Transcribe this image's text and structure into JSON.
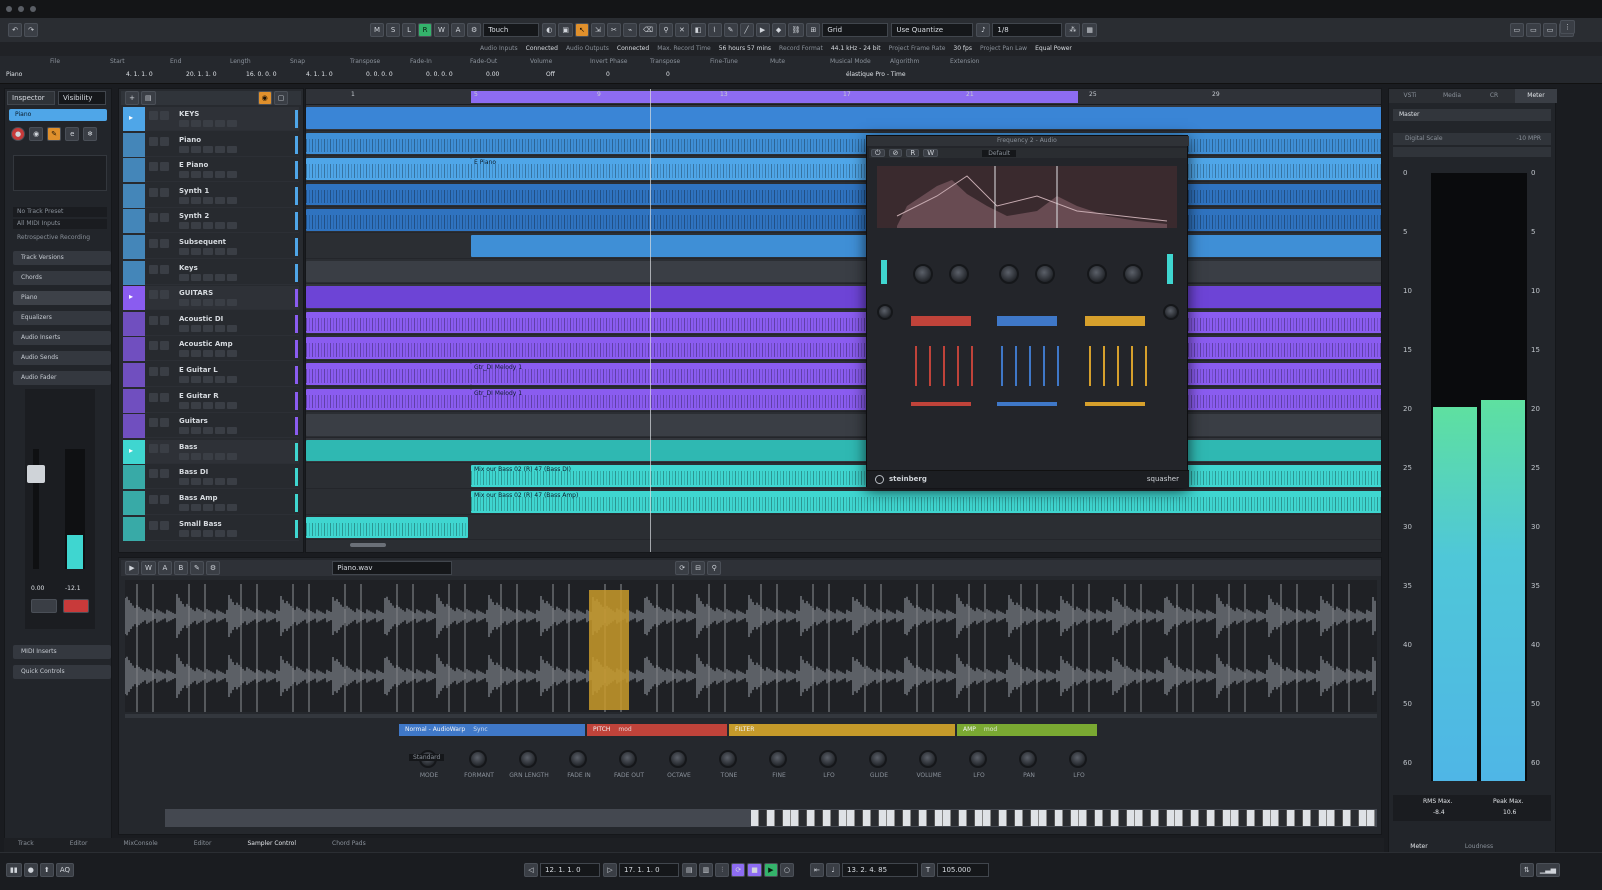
{
  "toolbar": {
    "automation_mode": "Touch",
    "grid_mode": "Grid",
    "quantize_mode": "Use Quantize",
    "quantize_value": "1/8"
  },
  "status_line": [
    "Audio Inputs",
    "Connected",
    "Audio Outputs",
    "Connected",
    "Max. Record Time",
    "56 hours 57 mins",
    "Record Format",
    "44.1 kHz - 24 bit",
    "Project Frame Rate",
    "30 fps",
    "Project Pan Law",
    "Equal Power"
  ],
  "info_line": {
    "headers": [
      "File",
      "Start",
      "End",
      "Length",
      "Snap",
      "Transpose",
      "Fade-In",
      "Fade-Out",
      "Volume",
      "Invert Phase",
      "Transpose",
      "Fine-Tune",
      "Mute",
      "Musical Mode",
      "Algorithm",
      "Extension"
    ],
    "track_name": "Piano",
    "start": "4. 1. 1. 0",
    "end": "20. 1. 1. 0",
    "length": "16. 0. 0. 0",
    "snap": "4. 1. 1. 0",
    "fade_in": "0. 0. 0. 0",
    "fade_out": "0. 0. 0. 0",
    "volume": "0.00",
    "invert_phase": "Off",
    "transpose": "0",
    "fine_tune": "0",
    "algorithm": "élastique Pro - Time"
  },
  "inspector": {
    "tabs": [
      "Inspector",
      "Visibility"
    ],
    "track": "Piano",
    "input": "No Track Preset",
    "midi_inputs": "All MIDI Inputs",
    "retro": "Retrospective Recording",
    "sections": [
      "Track Versions",
      "Chords",
      "Piano",
      "Equalizers",
      "Audio Inserts",
      "Audio Sends",
      "Audio Fader",
      "MIDI Inserts",
      "Quick Controls"
    ],
    "fader_value": "0.00",
    "fader_value_right": "-12.1"
  },
  "tracks": [
    {
      "name": "KEYS",
      "color": "#4fa6e8",
      "folder": true
    },
    {
      "name": "Piano",
      "color": "#4fa6e8"
    },
    {
      "name": "E Piano",
      "color": "#4fa6e8"
    },
    {
      "name": "Synth 1",
      "color": "#4fa6e8"
    },
    {
      "name": "Synth 2",
      "color": "#4fa6e8"
    },
    {
      "name": "Subsequent",
      "color": "#4fa6e8"
    },
    {
      "name": "Keys",
      "color": "#4fa6e8"
    },
    {
      "name": "GUITARS",
      "color": "#8a5cf0",
      "folder": true
    },
    {
      "name": "Acoustic DI",
      "color": "#8a5cf0"
    },
    {
      "name": "Acoustic Amp",
      "color": "#8a5cf0"
    },
    {
      "name": "E Guitar L",
      "color": "#8a5cf0"
    },
    {
      "name": "E Guitar R",
      "color": "#8a5cf0"
    },
    {
      "name": "Guitars",
      "color": "#8a5cf0"
    },
    {
      "name": "Bass",
      "color": "#3fd6d0",
      "folder": true
    },
    {
      "name": "Bass DI",
      "color": "#3fd6d0"
    },
    {
      "name": "Bass Amp",
      "color": "#3fd6d0"
    },
    {
      "name": "Small Bass",
      "color": "#3fd6d0"
    }
  ],
  "clip_labels": {
    "epiano": "E Piano",
    "gtr1": "Gtr_DI Melody 1",
    "gtr2": "Gtr_DI Melody 1",
    "bass1": "Mix our Bass 02 (R) 47 (Bass DI)",
    "bass2": "Mix our Bass 02 (R) 47 (Bass Amp)"
  },
  "ruler": [
    "1",
    "5",
    "9",
    "13",
    "17",
    "21",
    "25",
    "29"
  ],
  "plugin": {
    "title": "Frequency 2 - Audio",
    "preset": "Default",
    "brand": "steinberg",
    "product": "squasher"
  },
  "right_zone": {
    "tabs": [
      "VSTi",
      "Media",
      "CR",
      "Meter"
    ],
    "section": "Master",
    "loudness_label": "Digital Scale",
    "loudness_value": "-10 MPR",
    "scale": [
      "0",
      "5",
      "10",
      "15",
      "20",
      "25",
      "30",
      "35",
      "40",
      "50",
      "60"
    ],
    "meter_left_level": 0.62,
    "meter_right_level": 0.63,
    "rms_label": "RMS Max.",
    "rms_value": "-8.4",
    "peak_label": "Peak Max.",
    "peak_value": "10.6",
    "bottom_tabs": [
      "Meter",
      "Loudness"
    ]
  },
  "sampler": {
    "file": "Piano.wav",
    "sections": [
      {
        "name": "Normal - AudioWarp",
        "color": "#3f78c8",
        "badge": "Sync"
      },
      {
        "name": "PITCH",
        "color": "#c0433a",
        "badge": "mod"
      },
      {
        "name": "FILTER",
        "color": "#c59a2a",
        "badge": ""
      },
      {
        "name": "AMP",
        "color": "#7aa932",
        "badge": "mod"
      }
    ],
    "knob_labels": [
      "MODE",
      "FORMANT",
      "GRN LENGTH",
      "FADE IN",
      "FADE OUT",
      "OCTAVE",
      "TONE",
      "FINE",
      "LFO",
      "GLIDE",
      "VOLUME",
      "LFO",
      "PAN",
      "LFO"
    ],
    "mode_value": "Standard"
  },
  "lower_tabs": [
    "Track",
    "Editor",
    "MixConsole",
    "Editor",
    "Sampler Control",
    "Chord Pads"
  ],
  "transport": {
    "left_locator": "12. 1. 1.   0",
    "right_locator": "17. 1. 1.   0",
    "position": "13. 2. 4. 85",
    "tempo": "105.000"
  }
}
